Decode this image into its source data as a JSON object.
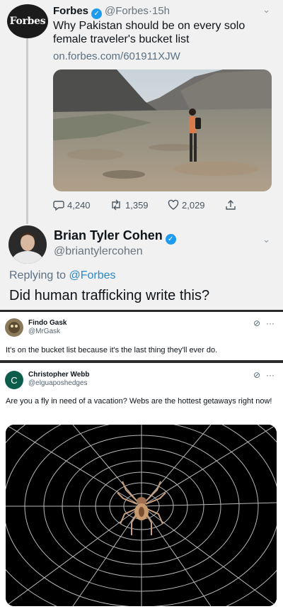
{
  "forbes_tweet": {
    "avatar_text": "Forbes",
    "name": "Forbes",
    "handle": "@Forbes",
    "separator": "·",
    "time": "15h",
    "text": "Why Pakistan should be on every solo female traveler's bucket list",
    "link": "on.forbes.com/601911XJW",
    "replies": "4,240",
    "retweets": "1,359",
    "likes": "2,029"
  },
  "brian_tweet": {
    "name": "Brian Tyler Cohen",
    "handle": "@briantylercohen",
    "replying_prefix": "Replying to",
    "replying_to": "@Forbes",
    "text": "Did human trafficking write this?"
  },
  "findo_reply": {
    "name": "Findo Gask",
    "handle": "@MrGask",
    "text": "It's on the bucket list because it's the last thing they'll ever do."
  },
  "webb_reply": {
    "avatar_letter": "C",
    "name": "Christopher Webb",
    "handle": "@elguaposhedges",
    "text": "Are you a fly in need of a vacation? Webs are the hottest getaways right now!"
  },
  "icons": {
    "more": "···",
    "chevron": "⌄"
  },
  "colors": {
    "verified": "#1d9bf0",
    "link": "#5b7083",
    "mention": "#2a88c9",
    "webb_avatar": "#0b5d4b"
  }
}
